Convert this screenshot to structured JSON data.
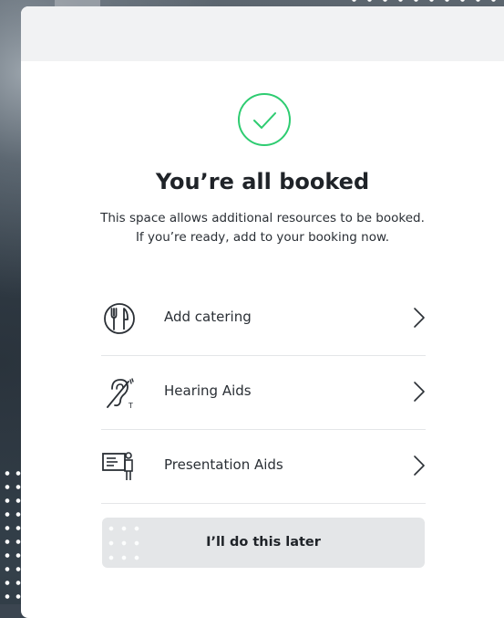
{
  "modal": {
    "title": "You’re all booked",
    "subtitle_line1": "This space allows additional resources to be booked.",
    "subtitle_line2": "If you’re ready, add to your booking now.",
    "success_icon": "check-circle-icon",
    "accent_color": "#2ecc71",
    "options": [
      {
        "label": "Add catering",
        "icon": "catering-icon"
      },
      {
        "label": "Hearing Aids",
        "icon": "hearing-aid-icon"
      },
      {
        "label": "Presentation Aids",
        "icon": "presentation-icon"
      }
    ],
    "later_button": "I’ll do this later"
  }
}
